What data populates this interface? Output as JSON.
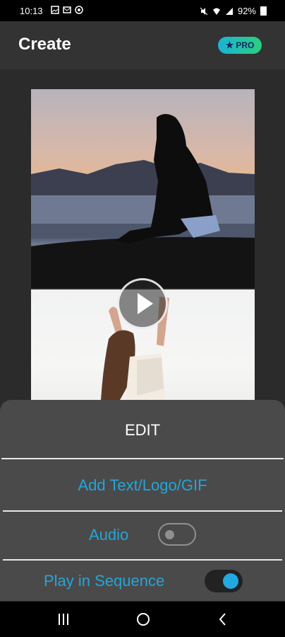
{
  "status_bar": {
    "time": "10:13",
    "battery": "92%",
    "left_icons": [
      "gallery-icon",
      "mail-icon",
      "screen-icon"
    ],
    "right_icons": [
      "mute-icon",
      "wifi-icon",
      "signal-icon",
      "battery-icon"
    ]
  },
  "header": {
    "title": "Create",
    "pro_label": "PRO",
    "pro_star": "★"
  },
  "sheet": {
    "title": "EDIT",
    "add_text_label": "Add Text/Logo/GIF",
    "audio_label": "Audio",
    "audio_enabled": false,
    "sequence_label": "Play in Sequence",
    "sequence_enabled": true
  },
  "colors": {
    "accent": "#22a6d8",
    "toggle_on": "#20a9e2",
    "pro_gradient_start": "#1ab3d6",
    "pro_gradient_end": "#2bd07a"
  },
  "nav": {
    "items": [
      "recents-icon",
      "home-icon",
      "back-icon"
    ]
  }
}
